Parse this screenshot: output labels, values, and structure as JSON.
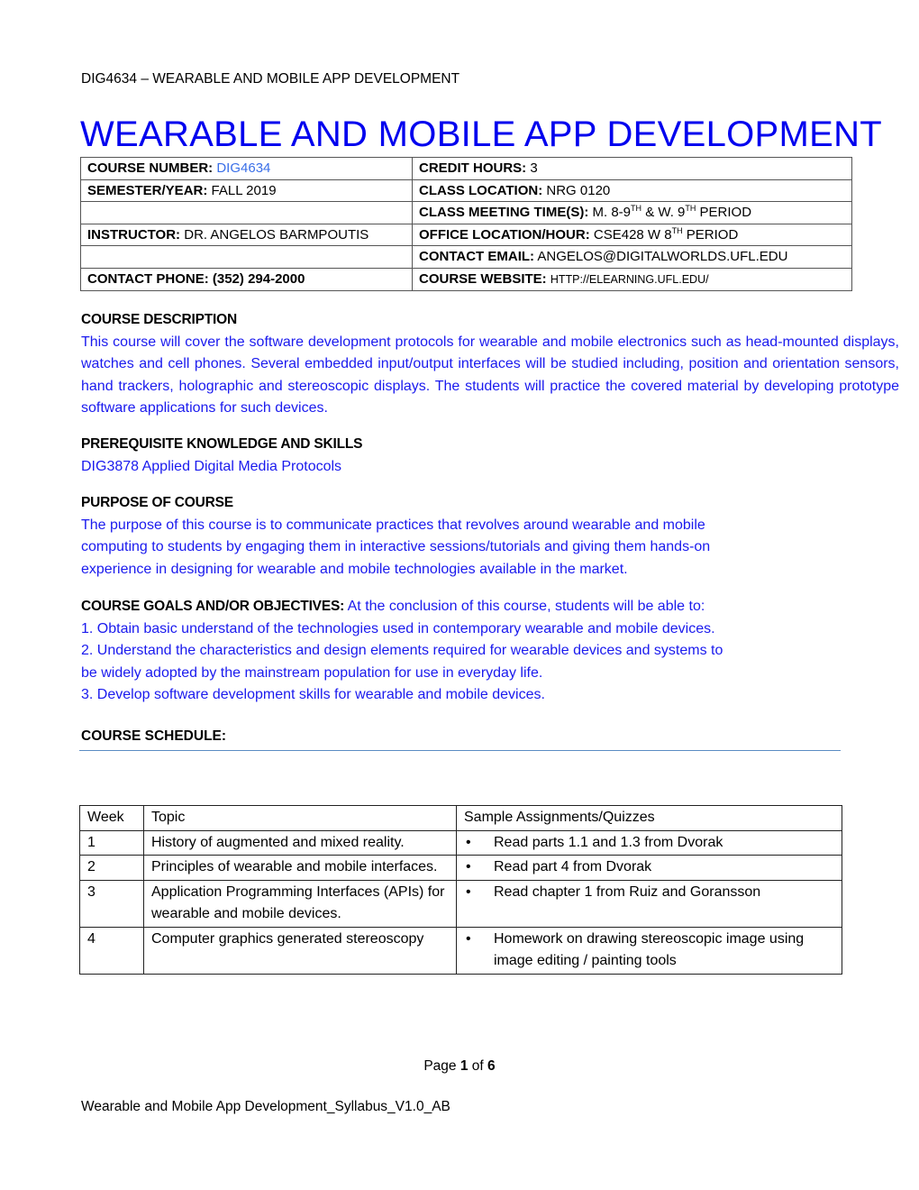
{
  "header": {
    "running_title": "DIG4634 – WEARABLE AND MOBILE APP DEVELOPMENT",
    "title": "WEARABLE AND MOBILE APP DEVELOPMENT"
  },
  "info_table": {
    "course_number": {
      "label": "COURSE NUMBER:",
      "value": "DIG4634"
    },
    "credit_hours": {
      "label": "CREDIT HOURS:",
      "value": "3"
    },
    "semester_year": {
      "label": "SEMESTER/YEAR:",
      "value": "FALL 2019"
    },
    "class_location": {
      "label": "CLASS LOCATION:",
      "value": "NRG 0120"
    },
    "meeting_times": {
      "label": "CLASS MEETING TIME(S):",
      "part1": "M. 8-9",
      "sup1": "TH",
      "part2": "& W. 9",
      "sup2": "TH",
      "part3": "PERIOD"
    },
    "instructor": {
      "label": "INSTRUCTOR:",
      "value": "DR. ANGELOS BARMPOUTIS"
    },
    "office": {
      "label": "OFFICE LOCATION/HOUR:",
      "part1": "CSE428 W 8",
      "sup1": "TH",
      "part2": "PERIOD"
    },
    "contact_email": {
      "label": "CONTACT EMAIL:",
      "value": "ANGELOS@DIGITALWORLDS.UFL.EDU"
    },
    "contact_phone": {
      "label": "CONTACT PHONE: (352) 294-2000"
    },
    "course_website": {
      "label": "COURSE WEBSITE:",
      "value": "HTTP://ELEARNING.UFL.EDU/"
    }
  },
  "description": {
    "heading": "COURSE DESCRIPTION",
    "text": "This course will cover the software development protocols for wearable and mobile electronics such as head-mounted displays, watches and cell phones. Several embedded input/output interfaces will be studied including, position and orientation sensors, hand trackers, holographic and stereoscopic displays. The students will practice the covered material by developing prototype software applications for such devices."
  },
  "prerequisites": {
    "heading": "PREREQUISITE KNOWLEDGE AND SKILLS",
    "text": "DIG3878 Applied Digital Media Protocols"
  },
  "purpose": {
    "heading": "PURPOSE OF COURSE",
    "line1": "The purpose of this course is to communicate practices that revolves around wearable and mobile",
    "line2": "computing to students by engaging them in interactive sessions/tutorials and giving them hands-on",
    "line3": "experience in designing for wearable and mobile technologies available in the market."
  },
  "goals": {
    "heading": "COURSE GOALS AND/OR OBJECTIVES:",
    "intro": "At the conclusion of this course, students will be able to:",
    "items": [
      "1. Obtain basic understand of the technologies used in contemporary wearable and mobile devices.",
      "2. Understand the characteristics and design elements required for wearable devices and systems to",
      "be widely adopted by the mainstream population for use in everyday life.",
      "3. Develop software development skills for wearable and mobile devices."
    ]
  },
  "schedule": {
    "heading": "COURSE SCHEDULE:",
    "columns": [
      "Week",
      "Topic",
      "Sample Assignments/Quizzes"
    ],
    "rows": [
      {
        "week": "1",
        "topic": "History of augmented and mixed reality.",
        "assignment": "Read parts 1.1 and 1.3 from Dvorak"
      },
      {
        "week": "2",
        "topic": "Principles of wearable and mobile interfaces.",
        "assignment": "Read part 4 from Dvorak"
      },
      {
        "week": "3",
        "topic": "Application Programming Interfaces (APIs) for wearable and mobile devices.",
        "assignment": "Read chapter 1 from Ruiz and Goransson"
      },
      {
        "week": "4",
        "topic": "Computer graphics generated stereoscopy",
        "assignment": "Homework on drawing stereoscopic image using image editing / painting tools"
      }
    ],
    "bullet": "•"
  },
  "page_footer": {
    "page_word": "Page",
    "current": "1",
    "of_word": "of",
    "total": "6",
    "doc_name": "Wearable and Mobile App Development_Syllabus_V1.0_AB"
  }
}
